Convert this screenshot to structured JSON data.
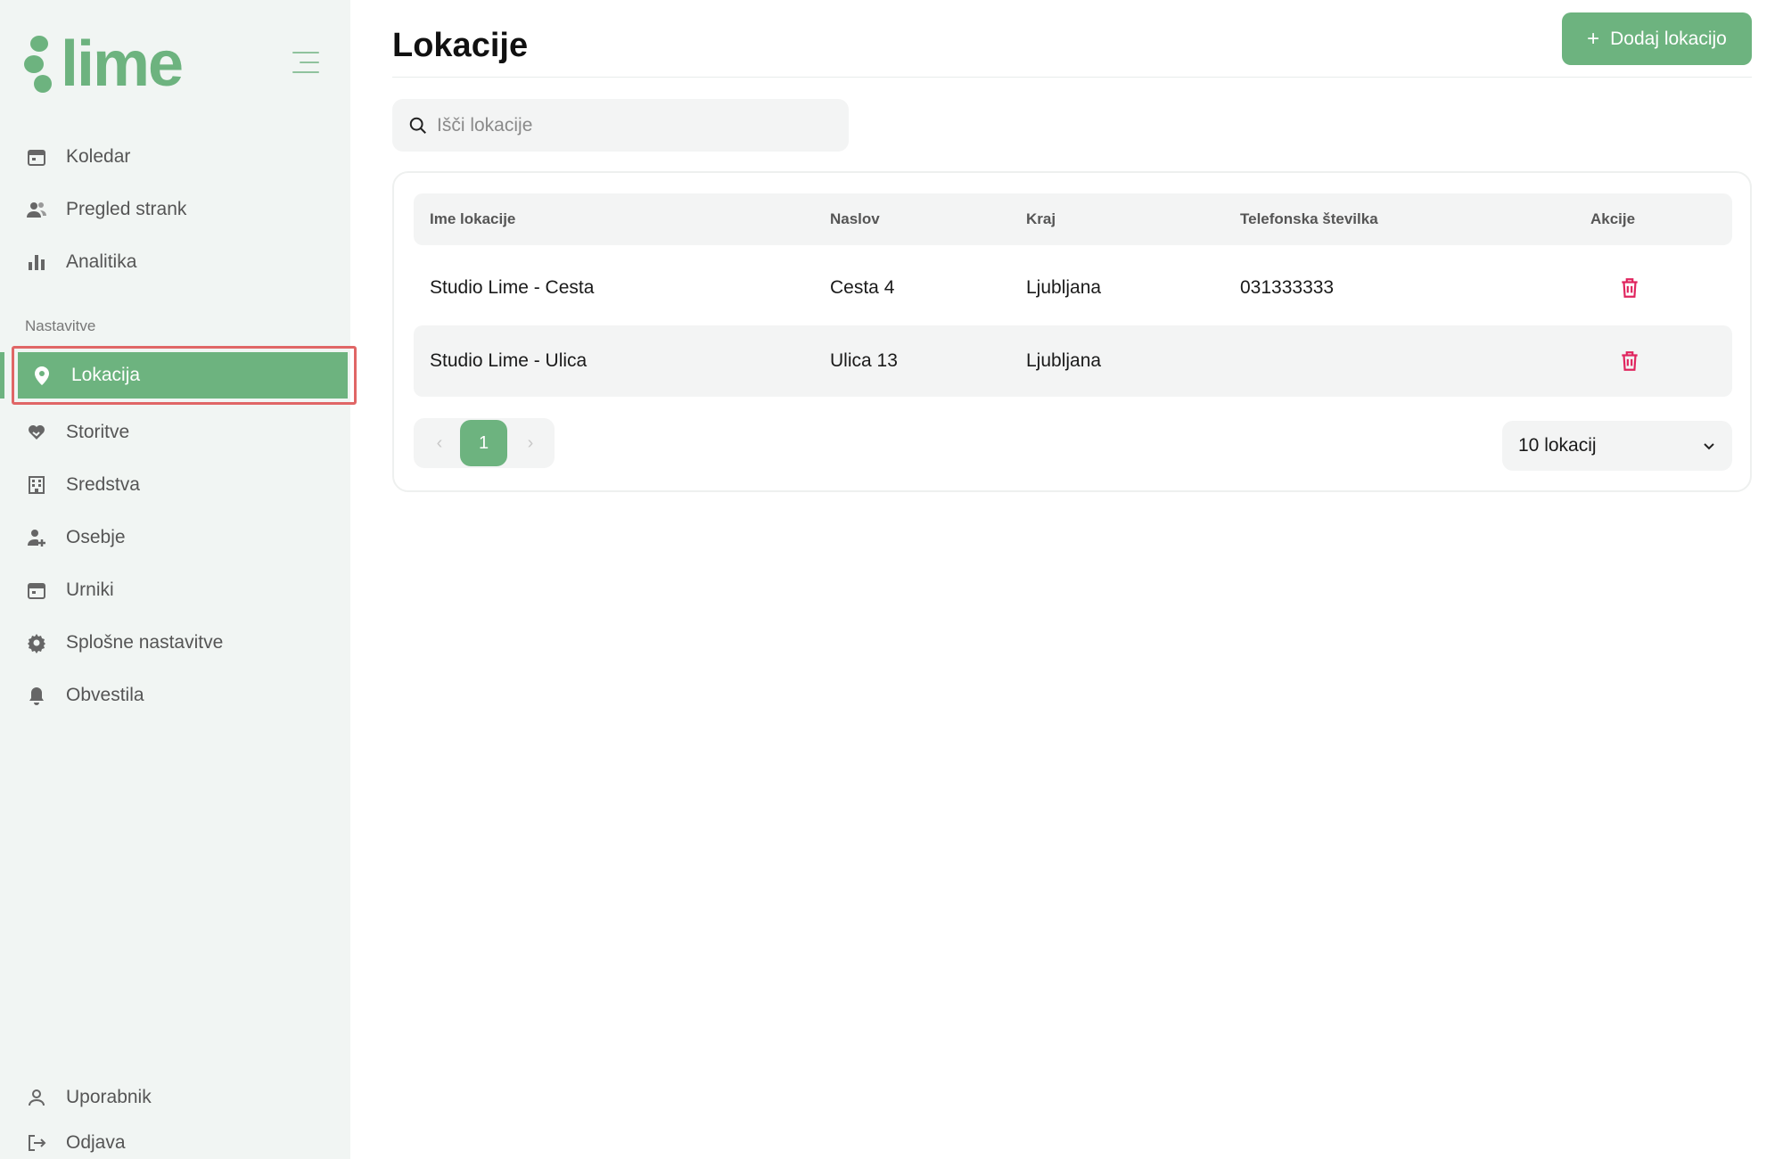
{
  "brand": {
    "name": "lime",
    "color": "#6db37f"
  },
  "sidebar": {
    "primary": [
      {
        "label": "Koledar",
        "icon": "calendar-icon"
      },
      {
        "label": "Pregled strank",
        "icon": "users-icon"
      },
      {
        "label": "Analitika",
        "icon": "bar-chart-icon"
      }
    ],
    "section_label": "Nastavitve",
    "settings": [
      {
        "label": "Lokacija",
        "icon": "location-pin-icon",
        "active": true
      },
      {
        "label": "Storitve",
        "icon": "heart-hand-icon"
      },
      {
        "label": "Sredstva",
        "icon": "building-icon"
      },
      {
        "label": "Osebje",
        "icon": "user-plus-icon"
      },
      {
        "label": "Urniki",
        "icon": "calendar-icon"
      },
      {
        "label": "Splošne nastavitve",
        "icon": "gear-icon"
      },
      {
        "label": "Obvestila",
        "icon": "bell-icon"
      }
    ],
    "footer": [
      {
        "label": "Uporabnik",
        "icon": "user-icon"
      },
      {
        "label": "Odjava",
        "icon": "logout-icon"
      }
    ]
  },
  "header": {
    "title": "Lokacije",
    "add_button": "Dodaj lokacijo",
    "add_icon": "+"
  },
  "search": {
    "placeholder": "Išči lokacije"
  },
  "table": {
    "columns": [
      "Ime lokacije",
      "Naslov",
      "Kraj",
      "Telefonska številka",
      "Akcije"
    ],
    "rows": [
      {
        "name": "Studio Lime - Cesta",
        "address": "Cesta 4",
        "city": "Ljubljana",
        "phone": "031333333"
      },
      {
        "name": "Studio Lime - Ulica",
        "address": "Ulica 13",
        "city": "Ljubljana",
        "phone": ""
      }
    ]
  },
  "pagination": {
    "prev": "‹",
    "next": "›",
    "current_page": "1",
    "page_size": "10 lokacij"
  },
  "colors": {
    "accent": "#6db37f",
    "sidebar_bg": "#f1f5f3",
    "delete": "#e0245e",
    "highlight_frame": "#e06666"
  }
}
